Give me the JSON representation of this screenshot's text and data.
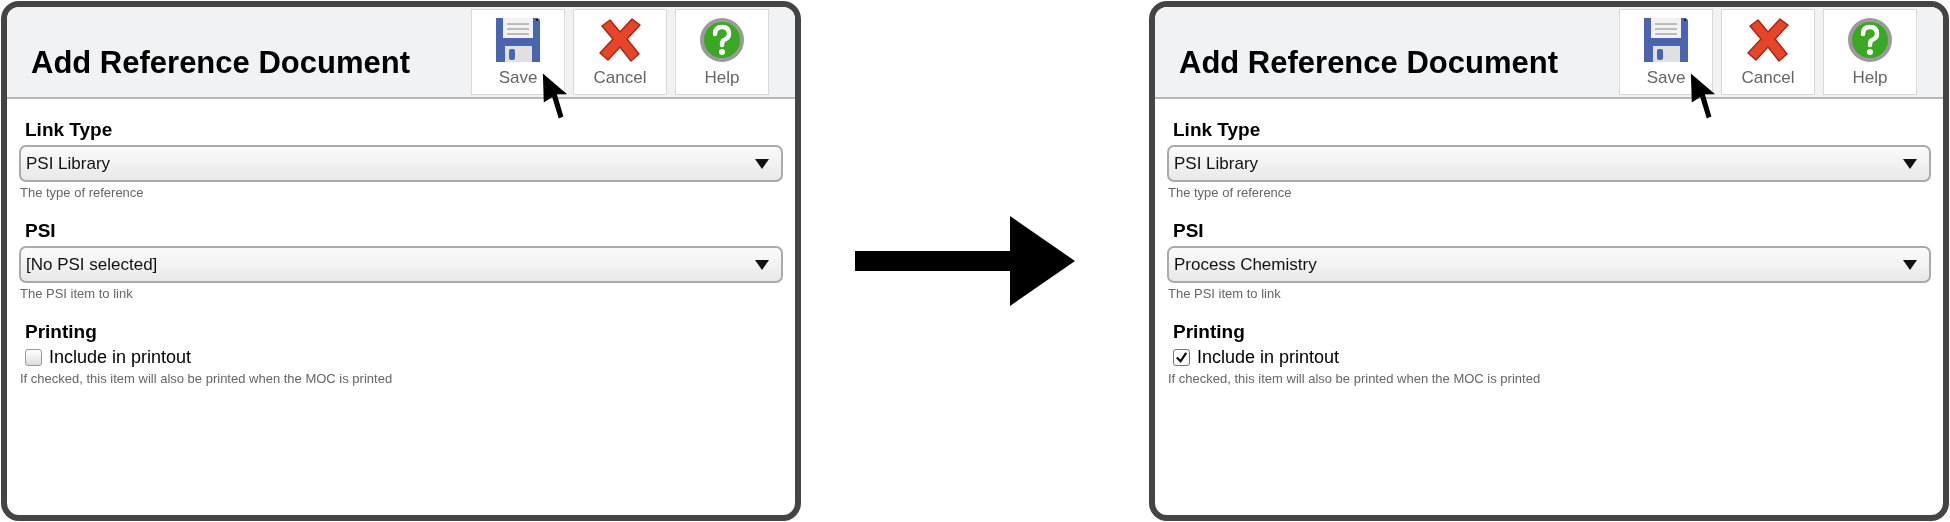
{
  "panels": [
    {
      "title": "Add Reference Document",
      "toolbar": [
        {
          "kind": "save",
          "label": "Save"
        },
        {
          "kind": "cancel",
          "label": "Cancel"
        },
        {
          "kind": "help",
          "label": "Help"
        }
      ],
      "fields": [
        {
          "kind": "select",
          "label": "Link Type",
          "value": "PSI Library",
          "hint": "The type of reference"
        },
        {
          "kind": "select",
          "label": "PSI",
          "value": "[No PSI selected]",
          "hint": "The PSI item to link"
        },
        {
          "kind": "checkbox",
          "label": "Printing",
          "option": "Include in printout",
          "checked": false,
          "hint": "If checked, this item will also be printed when the MOC is printed"
        }
      ]
    },
    {
      "title": "Add Reference Document",
      "toolbar": [
        {
          "kind": "save",
          "label": "Save"
        },
        {
          "kind": "cancel",
          "label": "Cancel"
        },
        {
          "kind": "help",
          "label": "Help"
        }
      ],
      "fields": [
        {
          "kind": "select",
          "label": "Link Type",
          "value": "PSI Library",
          "hint": "The type of reference"
        },
        {
          "kind": "select",
          "label": "PSI",
          "value": "Process Chemistry",
          "hint": "The PSI item to link"
        },
        {
          "kind": "checkbox",
          "label": "Printing",
          "option": "Include in printout",
          "checked": true,
          "hint": "If checked, this item will also be printed when the MOC is printed"
        }
      ]
    }
  ]
}
